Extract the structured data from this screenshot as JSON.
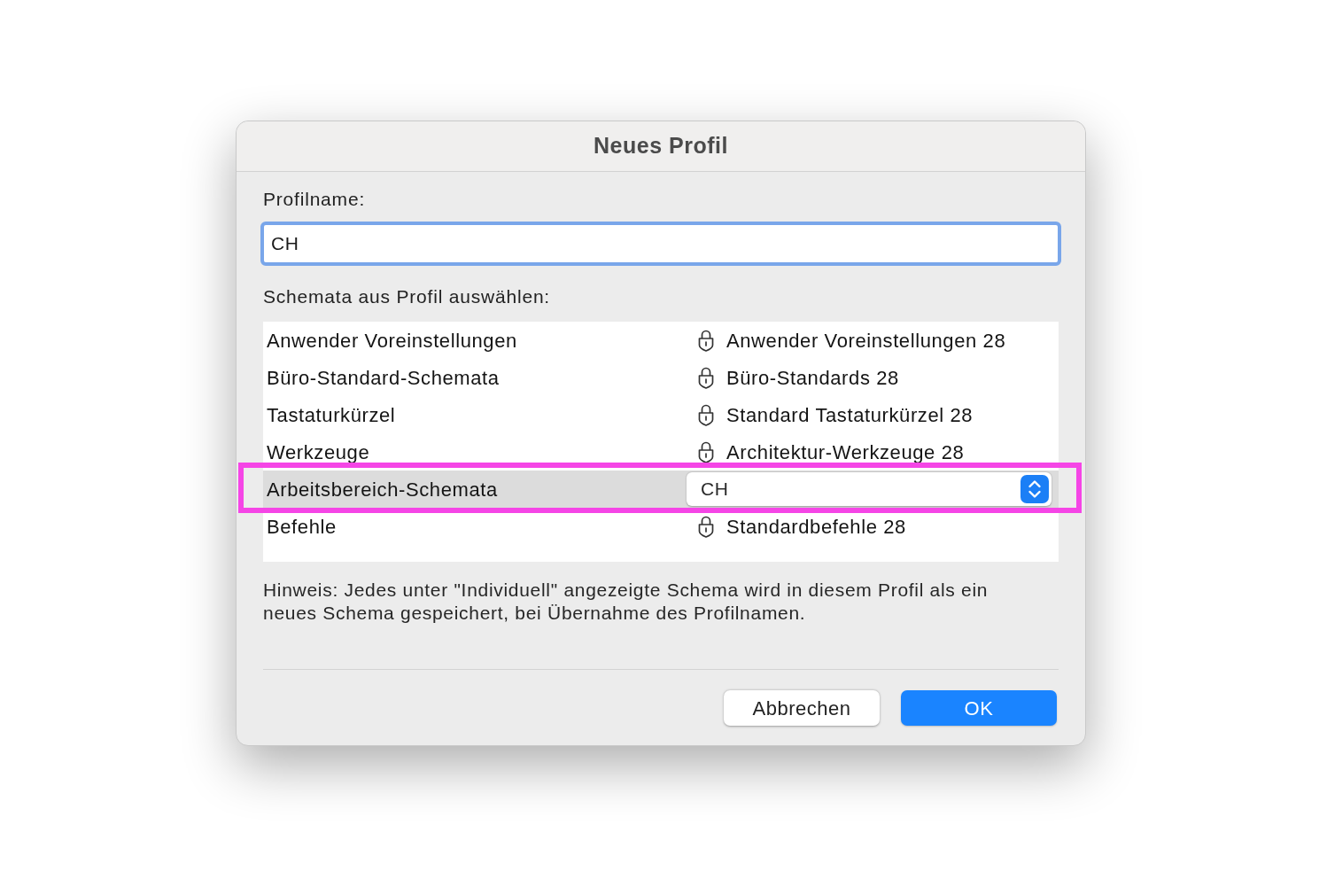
{
  "window": {
    "title": "Neues Profil"
  },
  "profile_name": {
    "label": "Profilname:",
    "value": "CH",
    "focused": true
  },
  "schemes": {
    "label": "Schemata aus Profil auswählen:",
    "rows": [
      {
        "label": "Anwender Voreinstellungen",
        "kind": "locked",
        "value": "Anwender Voreinstellungen 28",
        "selected": false,
        "highlighted": false
      },
      {
        "label": "Büro-Standard-Schemata",
        "kind": "locked",
        "value": "Büro-Standards 28",
        "selected": false,
        "highlighted": false
      },
      {
        "label": "Tastaturkürzel",
        "kind": "locked",
        "value": "Standard Tastaturkürzel 28",
        "selected": false,
        "highlighted": false
      },
      {
        "label": "Werkzeuge",
        "kind": "locked",
        "value": "Architektur-Werkzeuge 28",
        "selected": false,
        "highlighted": false
      },
      {
        "label": "Arbeitsbereich-Schemata",
        "kind": "popup",
        "value": "CH",
        "selected": true,
        "highlighted": true
      },
      {
        "label": "Befehle",
        "kind": "locked",
        "value": "Standardbefehle 28",
        "selected": false,
        "highlighted": false
      }
    ]
  },
  "note": "Hinweis: Jedes unter \"Individuell\" angezeigte Schema wird in diesem Profil als ein neues Schema gespeichert, bei Übernahme des Profilnamen.",
  "buttons": [
    {
      "label": "Abbrechen",
      "kind": "secondary"
    },
    {
      "label": "OK",
      "kind": "default"
    }
  ]
}
